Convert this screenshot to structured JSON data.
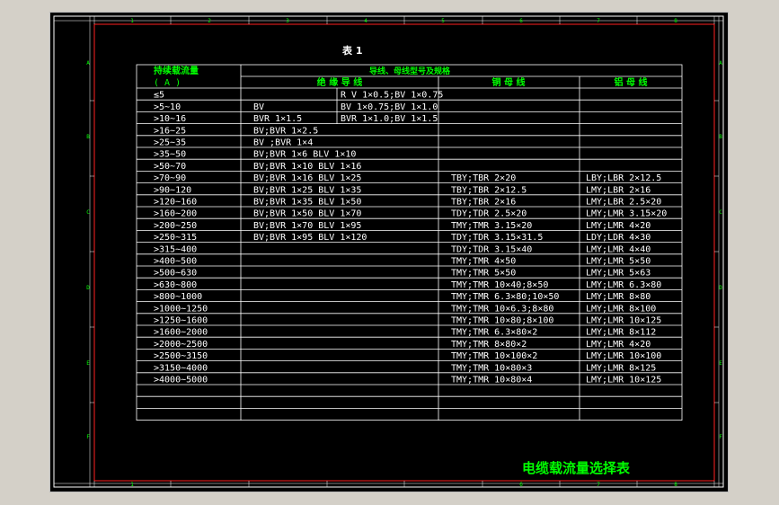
{
  "drawing": {
    "table_title": "表  1",
    "drawing_title": "电缆载流量选择表",
    "col_numbers": [
      "1",
      "2",
      "3",
      "4",
      "5",
      "6",
      "7",
      "8"
    ],
    "row_letters": [
      "A",
      "B",
      "C",
      "D",
      "E",
      "F"
    ],
    "bottom_col_numbers": [
      "1",
      "6",
      "7",
      "8"
    ]
  },
  "table": {
    "header": {
      "current_label": "持续载流量",
      "current_unit": "( A )",
      "group_label": "导线、母线型号及规格",
      "insulated_label": "绝 缘 导 线",
      "copper_label": "铜 母 线",
      "aluminum_label": "铝 母 线"
    },
    "rows": [
      {
        "current": "≤5",
        "wire": "",
        "wire2": "R V 1×0.5;BV 1×0.75",
        "copper": "",
        "aluminum": ""
      },
      {
        "current": ">5~10",
        "wire": "BV",
        "wire2": "BV 1×0.75;BV 1×1.0",
        "copper": "",
        "aluminum": ""
      },
      {
        "current": ">10~16",
        "wire": "BVR    1×1.5",
        "wire2": "BVR 1×1.0;BV 1×1.5",
        "copper": "",
        "aluminum": ""
      },
      {
        "current": ">16~25",
        "wire": "BV;BVR 1×2.5",
        "wire2": "",
        "copper": "",
        "aluminum": ""
      },
      {
        "current": ">25~35",
        "wire": "BV ;BVR 1×4",
        "wire2": "",
        "copper": "",
        "aluminum": ""
      },
      {
        "current": ">35~50",
        "wire": "BV;BVR 1×6  BLV 1×10",
        "wire2": "",
        "copper": "",
        "aluminum": ""
      },
      {
        "current": ">50~70",
        "wire": "BV;BVR 1×10  BLV 1×16",
        "wire2": "",
        "copper": "",
        "aluminum": ""
      },
      {
        "current": ">70~90",
        "wire": "BV;BVR 1×16  BLV 1×25",
        "wire2": "",
        "copper": "TBY;TBR 2×20",
        "aluminum": "LBY;LBR 2×12.5"
      },
      {
        "current": ">90~120",
        "wire": "BV;BVR 1×25  BLV 1×35",
        "wire2": "",
        "copper": "TBY;TBR 2×12.5",
        "aluminum": "LMY;LBR 2×16"
      },
      {
        "current": ">120~160",
        "wire": "BV;BVR 1×35  BLV 1×50",
        "wire2": "",
        "copper": "TBY;TBR 2×16",
        "aluminum": "LMY;LBR 2.5×20"
      },
      {
        "current": ">160~200",
        "wire": "BV;BVR 1×50  BLV 1×70",
        "wire2": "",
        "copper": "TDY;TDR 2.5×20",
        "aluminum": "LMY;LMR 3.15×20"
      },
      {
        "current": ">200~250",
        "wire": "BV;BVR 1×70  BLV 1×95",
        "wire2": "",
        "copper": "TMY;TMR 3.15×20",
        "aluminum": "LMY;LMR 4×20"
      },
      {
        "current": ">250~315",
        "wire": "BV;BVR 1×95  BLV 1×120",
        "wire2": "",
        "copper": "TDY;TDR 3.15×31.5",
        "aluminum": "LDY;LDR 4×30"
      },
      {
        "current": ">315~400",
        "wire": "",
        "wire2": "",
        "copper": "TDY;TDR 3.15×40",
        "aluminum": "LMY;LMR 4×40"
      },
      {
        "current": ">400~500",
        "wire": "",
        "wire2": "",
        "copper": "TMY;TMR 4×50",
        "aluminum": "LMY;LMR 5×50"
      },
      {
        "current": ">500~630",
        "wire": "",
        "wire2": "",
        "copper": "TMY;TMR 5×50",
        "aluminum": "LMY;LMR 5×63"
      },
      {
        "current": ">630~800",
        "wire": "",
        "wire2": "",
        "copper": "TMY;TMR 10×40;8×50",
        "aluminum": "LMY;LMR 6.3×80"
      },
      {
        "current": ">800~1000",
        "wire": "",
        "wire2": "",
        "copper": "TMY;TMR 6.3×80;10×50",
        "aluminum": "LMY;LMR 8×80"
      },
      {
        "current": ">1000~1250",
        "wire": "",
        "wire2": "",
        "copper": "TMY;TMR 10×6.3;8×80",
        "aluminum": "LMY;LMR 8×100"
      },
      {
        "current": ">1250~1600",
        "wire": "",
        "wire2": "",
        "copper": "TMY;TMR 10×80;8×100",
        "aluminum": "LMY;LMR 10×125"
      },
      {
        "current": ">1600~2000",
        "wire": "",
        "wire2": "",
        "copper": "TMY;TMR 6.3×80×2",
        "aluminum": "LMY;LMR 8×112"
      },
      {
        "current": ">2000~2500",
        "wire": "",
        "wire2": "",
        "copper": "TMY;TMR  8×80×2",
        "aluminum": "LMY;LMR 4×20"
      },
      {
        "current": ">2500~3150",
        "wire": "",
        "wire2": "",
        "copper": "TMY;TMR 10×100×2",
        "aluminum": "LMY;LMR 10×100"
      },
      {
        "current": ">3150~4000",
        "wire": "",
        "wire2": "",
        "copper": "TMY;TMR 10×80×3",
        "aluminum": "LMY;LMR 8×125"
      },
      {
        "current": ">4000~5000",
        "wire": "",
        "wire2": "",
        "copper": "TMY;TMR 10×80×4",
        "aluminum": "LMY;LMR 10×125"
      },
      {
        "current": "",
        "wire": "",
        "wire2": "",
        "copper": "",
        "aluminum": ""
      },
      {
        "current": "",
        "wire": "",
        "wire2": "",
        "copper": "",
        "aluminum": ""
      },
      {
        "current": "",
        "wire": "",
        "wire2": "",
        "copper": "",
        "aluminum": ""
      }
    ]
  }
}
